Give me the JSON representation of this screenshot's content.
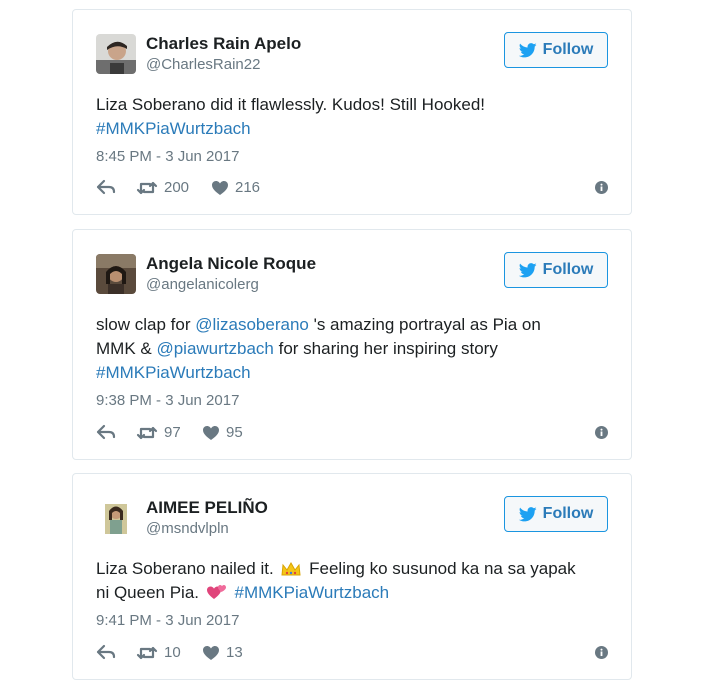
{
  "follow_label": "Follow",
  "colors": {
    "link": "#2b7bb9",
    "border": "#e1e8ed",
    "muted": "#697882"
  },
  "tweets": [
    {
      "name": "Charles Rain Apelo",
      "handle": "@CharlesRain22",
      "text_parts": [
        "Liza Soberano did it flawlessly. Kudos! Still Hooked!",
        "#MMKPiaWurtzbach"
      ],
      "time": "8:45 PM - 3 Jun 2017",
      "retweets": "200",
      "likes": "216"
    },
    {
      "name": "Angela Nicole Roque",
      "handle": "@angelanicolerg",
      "text_parts": [
        "slow clap for ",
        "@lizasoberano",
        " 's amazing portrayal as Pia on",
        "MMK & ",
        "@piawurtzbach",
        " for sharing her inspiring story",
        "#MMKPiaWurtzbach"
      ],
      "time": "9:38 PM - 3 Jun 2017",
      "retweets": "97",
      "likes": "95"
    },
    {
      "name": "AIMEE PELIÑO",
      "handle": "@msndvlpln",
      "text_parts": [
        "Liza Soberano nailed it. ",
        " Feeling ko susunod ka na sa yapak",
        "ni Queen Pia. ",
        "#MMKPiaWurtzbach"
      ],
      "time": "9:41 PM - 3 Jun 2017",
      "retweets": "10",
      "likes": "13"
    }
  ]
}
